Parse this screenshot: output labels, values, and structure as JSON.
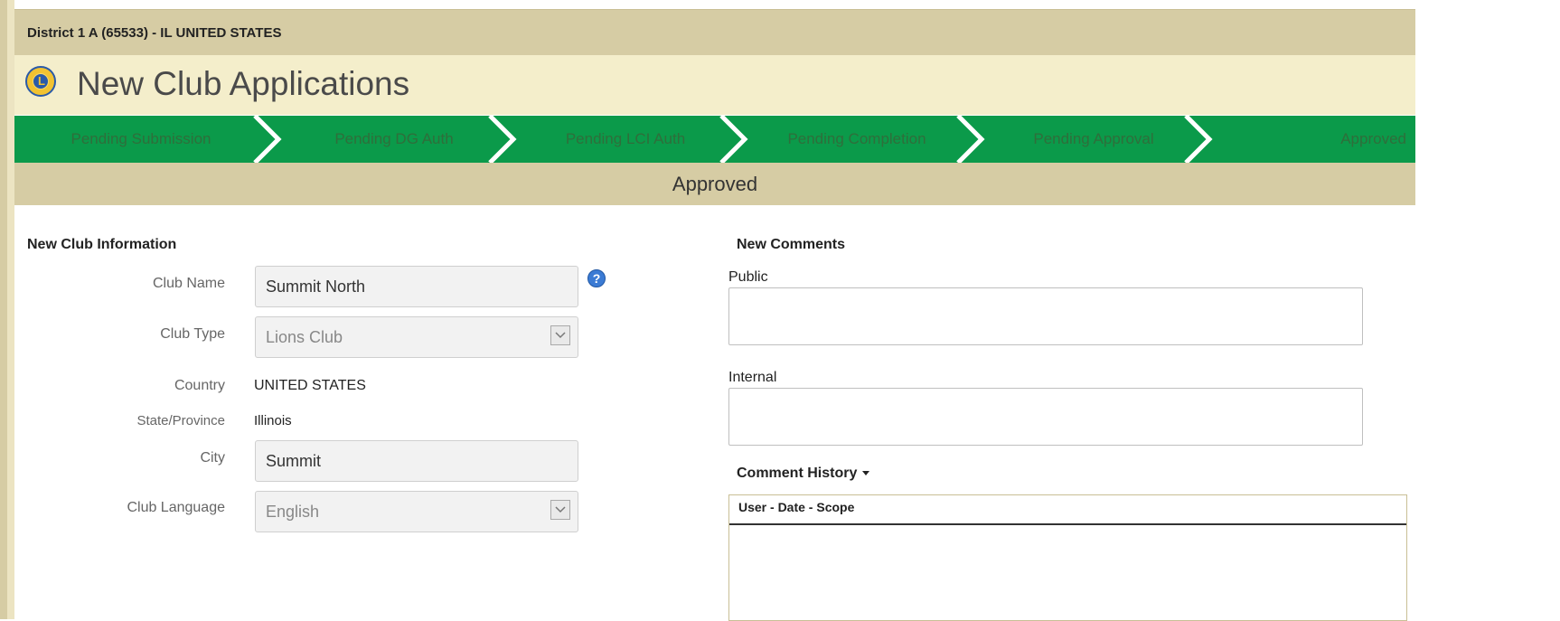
{
  "header": {
    "district": "District 1 A (65533) - IL UNITED STATES"
  },
  "page": {
    "title": "New Club Applications"
  },
  "steps": [
    {
      "label": "Pending Submission"
    },
    {
      "label": "Pending DG Auth"
    },
    {
      "label": "Pending LCI Auth"
    },
    {
      "label": "Pending Completion"
    },
    {
      "label": "Pending Approval"
    },
    {
      "label": "Approved"
    }
  ],
  "status": {
    "current": "Approved"
  },
  "club_info": {
    "heading": "New Club Information",
    "club_name_label": "Club Name",
    "club_name_value": "Summit North",
    "club_type_label": "Club Type",
    "club_type_value": "Lions Club",
    "country_label": "Country",
    "country_value": "UNITED STATES",
    "state_label": "State/Province",
    "state_value": "Illinois",
    "city_label": "City",
    "city_value": "Summit",
    "language_label": "Club Language",
    "language_value": "English"
  },
  "comments": {
    "heading": "New Comments",
    "public_label": "Public",
    "internal_label": "Internal",
    "history_label": "Comment History",
    "history_columns": "User - Date - Scope"
  },
  "colors": {
    "tan_band": "#d6cca4",
    "cream_band": "#f4eecb",
    "step_green": "#0b9a4a",
    "step_text": "#2f6e3b"
  },
  "icons": {
    "logo": "lions-logo-icon",
    "help": "help-icon",
    "dropdown": "chevron-down-icon",
    "history_toggle": "caret-down-icon"
  }
}
